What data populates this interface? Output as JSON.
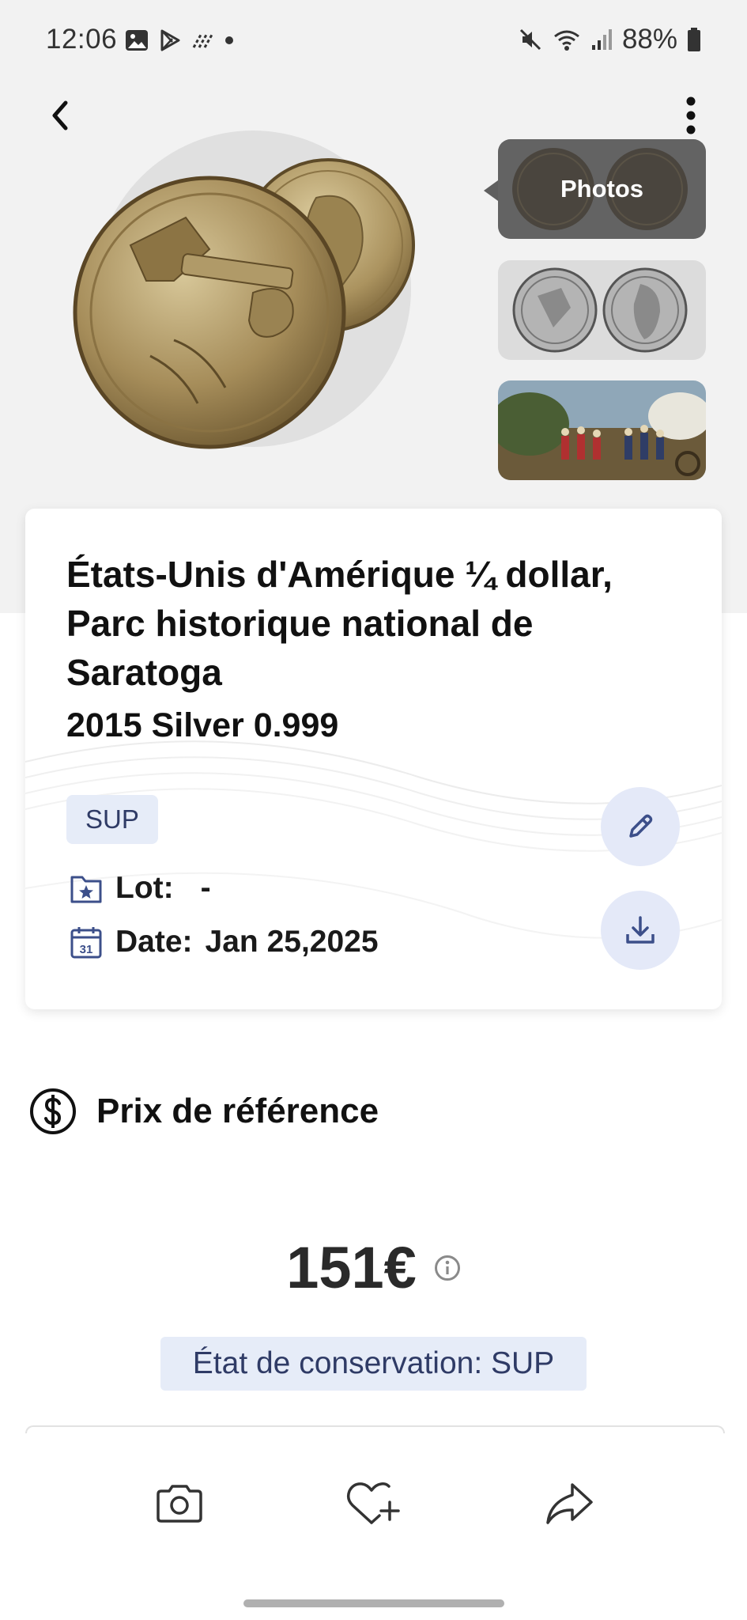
{
  "status_bar": {
    "time": "12:06",
    "battery": "88%"
  },
  "nav": {
    "back_icon": "chevron-left-icon",
    "more_icon": "more-vertical-icon"
  },
  "thumbnails": {
    "photos_label": "Photos"
  },
  "coin": {
    "title": "États-Unis d'Amérique ¼ dollar, Parc historique national de Saratoga",
    "subtitle": "2015 Silver 0.999",
    "grade": "SUP",
    "lot_label": "Lot:",
    "lot_value": "-",
    "date_label": "Date:",
    "date_value": "Jan 25,2025"
  },
  "price": {
    "section_title": "Prix de référence",
    "value": "151€",
    "condition": "État de conservation: SUP"
  },
  "colors": {
    "accent_bg": "#e6ecf8",
    "accent_text": "#2f3b66",
    "icon_blue": "#3c4f8a"
  }
}
